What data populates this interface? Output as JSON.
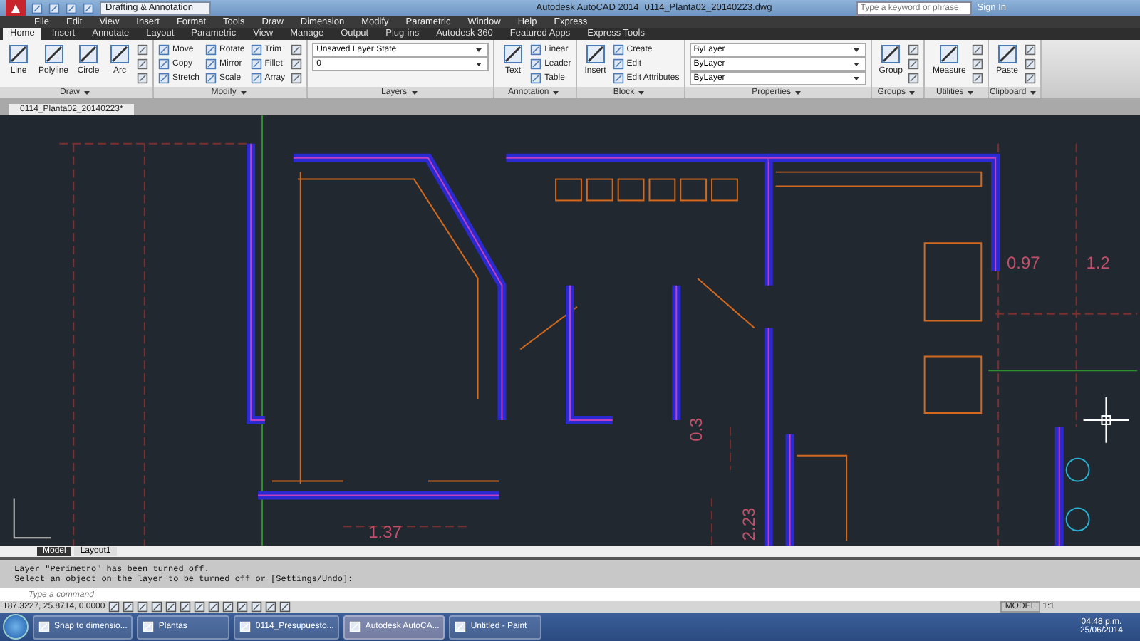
{
  "title_bar": {
    "workspace": "Drafting & Annotation",
    "title": "Autodesk AutoCAD 2014",
    "filename": "0114_Planta02_20140223.dwg",
    "search": {
      "placeholder": "Type a keyword or phrase"
    },
    "sign_in": "Sign In"
  },
  "menu_bar": [
    "File",
    "Edit",
    "View",
    "Insert",
    "Format",
    "Tools",
    "Draw",
    "Dimension",
    "Modify",
    "Parametric",
    "Window",
    "Help",
    "Express"
  ],
  "ribbon_tabs": [
    {
      "label": "Home",
      "selected": true
    },
    {
      "label": "Insert",
      "selected": false
    },
    {
      "label": "Annotate",
      "selected": false
    },
    {
      "label": "Layout",
      "selected": false
    },
    {
      "label": "Parametric",
      "selected": false
    },
    {
      "label": "View",
      "selected": false
    },
    {
      "label": "Manage",
      "selected": false
    },
    {
      "label": "Output",
      "selected": false
    },
    {
      "label": "Plug-ins",
      "selected": false
    },
    {
      "label": "Autodesk 360",
      "selected": false
    },
    {
      "label": "Featured Apps",
      "selected": false
    },
    {
      "label": "Express Tools",
      "selected": false
    }
  ],
  "ribbon_panels": [
    {
      "title": "Draw",
      "tools": [
        {
          "kind": "large",
          "label": "Line"
        },
        {
          "kind": "large",
          "label": "Polyline"
        },
        {
          "kind": "large",
          "label": "Circle"
        },
        {
          "kind": "large",
          "label": "Arc"
        },
        {
          "kind": "icon"
        },
        {
          "kind": "icon"
        },
        {
          "kind": "icon"
        }
      ]
    },
    {
      "title": "Modify",
      "tools": [
        {
          "kind": "small",
          "label": "Move"
        },
        {
          "kind": "small",
          "label": "Copy"
        },
        {
          "kind": "small",
          "label": "Stretch"
        },
        {
          "kind": "small",
          "label": "Rotate"
        },
        {
          "kind": "small",
          "label": "Mirror"
        },
        {
          "kind": "small",
          "label": "Scale"
        },
        {
          "kind": "small",
          "label": "Trim"
        },
        {
          "kind": "small",
          "label": "Fillet"
        },
        {
          "kind": "small",
          "label": "Array"
        },
        {
          "kind": "icon"
        },
        {
          "kind": "icon"
        },
        {
          "kind": "icon"
        }
      ]
    },
    {
      "title": "Layers",
      "tools": [
        {
          "kind": "dropdown",
          "value": "Unsaved Layer State"
        },
        {
          "kind": "dropdown",
          "value": "0"
        }
      ]
    },
    {
      "title": "Annotation",
      "tools": [
        {
          "kind": "large",
          "label": "Text"
        },
        {
          "kind": "small",
          "label": "Linear"
        },
        {
          "kind": "small",
          "label": "Leader"
        },
        {
          "kind": "small",
          "label": "Table"
        }
      ]
    },
    {
      "title": "Block",
      "tools": [
        {
          "kind": "large",
          "label": "Insert"
        },
        {
          "kind": "small",
          "label": "Create"
        },
        {
          "kind": "small",
          "label": "Edit"
        },
        {
          "kind": "small",
          "label": "Edit Attributes"
        }
      ]
    },
    {
      "title": "Properties",
      "tools": [
        {
          "kind": "dropdown",
          "value": "ByLayer"
        },
        {
          "kind": "dropdown",
          "value": "ByLayer"
        },
        {
          "kind": "dropdown",
          "value": "ByLayer"
        }
      ]
    },
    {
      "title": "Groups",
      "tools": [
        {
          "kind": "large",
          "label": "Group"
        },
        {
          "kind": "icon"
        },
        {
          "kind": "icon"
        },
        {
          "kind": "icon"
        }
      ]
    },
    {
      "title": "Utilities",
      "tools": [
        {
          "kind": "large",
          "label": "Measure"
        },
        {
          "kind": "icon"
        },
        {
          "kind": "icon"
        },
        {
          "kind": "icon"
        }
      ]
    },
    {
      "title": "Clipboard",
      "tools": [
        {
          "kind": "large",
          "label": "Paste"
        },
        {
          "kind": "icon"
        },
        {
          "kind": "icon"
        },
        {
          "kind": "icon"
        }
      ]
    }
  ],
  "document_tabs": [
    {
      "label": "0114_Planta02_20140223*",
      "selected": true
    }
  ],
  "drawing": {
    "dimension_labels": [
      "0.97",
      "1.2",
      "1.37",
      "0.3",
      "2.23"
    ]
  },
  "layout_tabs": [
    {
      "label": "Model",
      "selected": true
    },
    {
      "label": "Layout1",
      "selected": false
    }
  ],
  "command_history": [
    "Layer \"Perimetro\" has been turned off.",
    "Select an object on the layer to be turned off or [Settings/Undo]:"
  ],
  "command_input": {
    "placeholder": "Type a command"
  },
  "status_bar": {
    "coordinates": "187.3227, 25.8714, 0.0000",
    "space": "MODEL",
    "scale": "1:1"
  },
  "taskbar": {
    "tasks": [
      {
        "label": "Snap to dimensio...",
        "selected": false
      },
      {
        "label": "Plantas",
        "selected": false
      },
      {
        "label": "0114_Presupuesto...",
        "selected": false
      },
      {
        "label": "Autodesk AutoCA...",
        "selected": true
      },
      {
        "label": "Untitled - Paint",
        "selected": false
      }
    ],
    "time": "04:48 p.m.",
    "date": "25/06/2014"
  }
}
